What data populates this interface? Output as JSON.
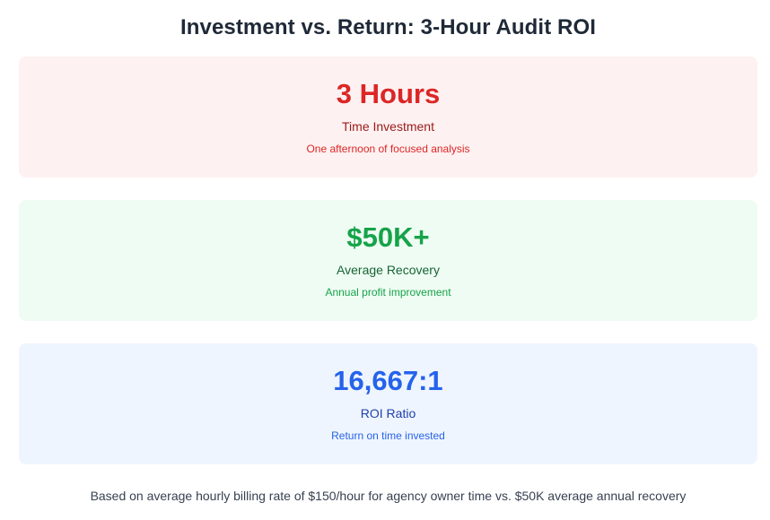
{
  "title": "Investment vs. Return: 3-Hour Audit ROI",
  "cards": [
    {
      "value": "3 Hours",
      "label": "Time Investment",
      "sublabel": "One afternoon of focused analysis",
      "color": "#dc2626",
      "background": "#fef2f2"
    },
    {
      "value": "$50K+",
      "label": "Average Recovery",
      "sublabel": "Annual profit improvement",
      "color": "#16a34a",
      "background": "#f0fdf4"
    },
    {
      "value": "16,667:1",
      "label": "ROI Ratio",
      "sublabel": "Return on time invested",
      "color": "#2563eb",
      "background": "#eff6ff"
    }
  ],
  "footnote": "Based on average hourly billing rate of $150/hour for agency owner time vs. $50K average annual recovery"
}
